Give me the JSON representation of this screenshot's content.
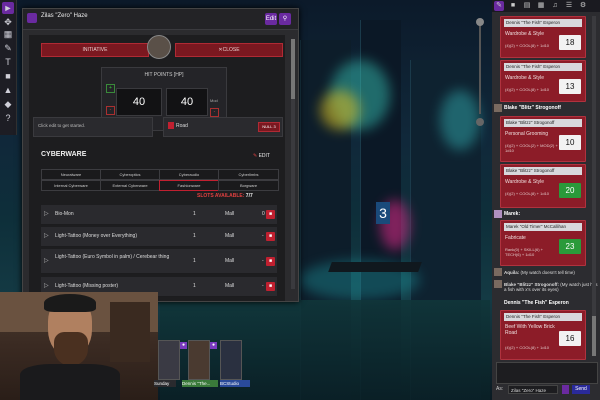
{
  "sheet": {
    "title": "Zilas \"Zero\" Haze",
    "edit_label": "Edit",
    "initiative_label": "INITIATIVE",
    "close_label": "CLOSE",
    "hp_label": "HIT POINTS [HP]",
    "hp_current": "40",
    "hp_max": "40",
    "hp_mod_label": "Mod",
    "left_prompt": "Click edit to get started.",
    "right_item": "Road",
    "right_badge": "NULL 3",
    "cyberware_title": "CYBERWARE",
    "cyberware_edit": "EDIT",
    "tabs_row1": [
      "Neuralware",
      "Cyberoptics",
      "Cyberaudio",
      "Cyberlimbs"
    ],
    "tabs_row2": [
      "Internal Cyberware",
      "External Cyberware",
      "Fashionware",
      "Borgware"
    ],
    "slots_label": "SLOTS AVAILABLE:",
    "slots_value": "7/7",
    "items": [
      {
        "name": "Bio-Mon",
        "qty": "1",
        "type": "Mall",
        "hum": "0"
      },
      {
        "name": "Light-Tattoo (Money over Everything)",
        "qty": "1",
        "type": "Mall",
        "hum": "-"
      },
      {
        "name": "Light-Tattoo (Euro Symbol in palm) / Cerebear thing",
        "qty": "1",
        "type": "Mall",
        "hum": "-"
      },
      {
        "name": "Light-Tattoo (Missing poster)",
        "qty": "1",
        "type": "Mall",
        "hum": "-"
      }
    ]
  },
  "players": [
    {
      "name": "Sunday"
    },
    {
      "name": "Dennis \"The..."
    },
    {
      "name": "BCStudio"
    }
  ],
  "chat": {
    "cards": [
      {
        "speaker": "",
        "header": "Dennis \"The Fish\" Esperon",
        "label": "Wardrobe & Style",
        "formula": "(4)(2) + COOL(8) + 1d10",
        "result": "18",
        "crit": false
      },
      {
        "speaker": "",
        "header": "Dennis \"The Fish\" Esperon",
        "label": "Wardrobe & Style",
        "formula": "(4)(2) + COOL(8) + 1d10",
        "result": "13",
        "crit": false
      },
      {
        "speaker": "Blake \"Blitz\" Strogonoff",
        "header": "Blake \"Blitzz\" Strogonoff",
        "label": "Personal Grooming",
        "formula": "(4)(2) + COOL(2) + MOD(2) + 1d10",
        "result": "10",
        "crit": false
      },
      {
        "speaker": "",
        "header": "Blake \"Blitzz\" Strogonoff",
        "label": "Wardrobe & Style",
        "formula": "(4)(2) + COOL(8) + 1d10",
        "result": "20",
        "crit": true
      },
      {
        "speaker": "Marek:",
        "header": "Marek \"Old Timer\" McCallihan",
        "label": "Fabricate",
        "formula": "Rank(0) + SKILL(6) + TECH(6) + 1d10",
        "result": "23",
        "crit": true
      },
      {
        "speaker": "Dennis \"The Fish\" Esperon",
        "header": "Dennis \"The Fish\" Esperon",
        "label": "Beef With Yellow Brick Road",
        "formula": "(4)(2) + COOL(8) + 1d10",
        "result": "16",
        "crit": false
      }
    ],
    "msg1_speaker": "Aquila:",
    "msg1_text": "(My watch doesn't tell time)",
    "msg2_speaker": "Blake \"Blitzz\" Strogonoff:",
    "msg2_text": "(My watch just has a fish with x's over its eyes)",
    "as_label": "As:",
    "as_value": "Zilas \"Zero\" Haze",
    "send_label": "Send"
  },
  "colors": {
    "accent_red": "#8c1c28",
    "accent_purple": "#6a2aa0",
    "crit_green": "#2a9a3a"
  }
}
